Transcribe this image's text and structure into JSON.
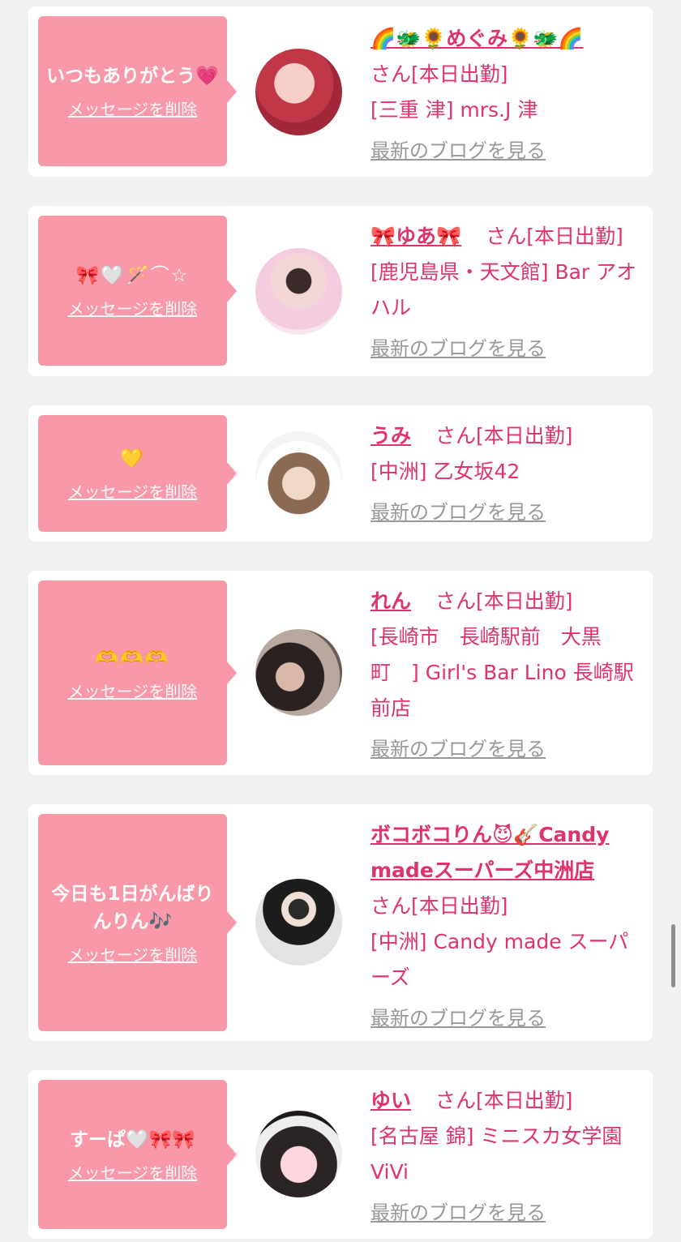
{
  "delete_label": "メッセージを削除",
  "blog_label": "最新のブログを見る",
  "san_label": "さん[本日出勤]",
  "colors": {
    "bubble": "#f898a8",
    "accent": "#e0336b",
    "muted": "#999999",
    "card": "#ffffff",
    "page": "#f1f1f1"
  },
  "cards": [
    {
      "message": "いつもありがとう💗",
      "name": "🌈🐲🌻めぐみ🌻🐲🌈",
      "location": "[三重 津] mrs.J 津"
    },
    {
      "message": "🎀🤍🪄⌒☆",
      "name": "🎀ゆあ🎀",
      "location": "[鹿児島県・天文館] Bar アオハル"
    },
    {
      "message": "💛",
      "name": "うみ",
      "location": "[中洲] 乙女坂42"
    },
    {
      "message": "🫶🫶🫶",
      "name": "れん",
      "location": "[長崎市　長崎駅前　大黒町　] Girl's Bar Lino 長崎駅前店"
    },
    {
      "message": "今日も1日がんばりんりん🎶",
      "name": "ボコボコりん😈🎸Candy madeスーパーズ中洲店",
      "location": "[中洲] Candy made スーパーズ"
    },
    {
      "message": "すーぱ🤍🎀🎀",
      "name": "ゆい",
      "location": "[名古屋 錦] ミニスカ女学園ViVi"
    }
  ]
}
